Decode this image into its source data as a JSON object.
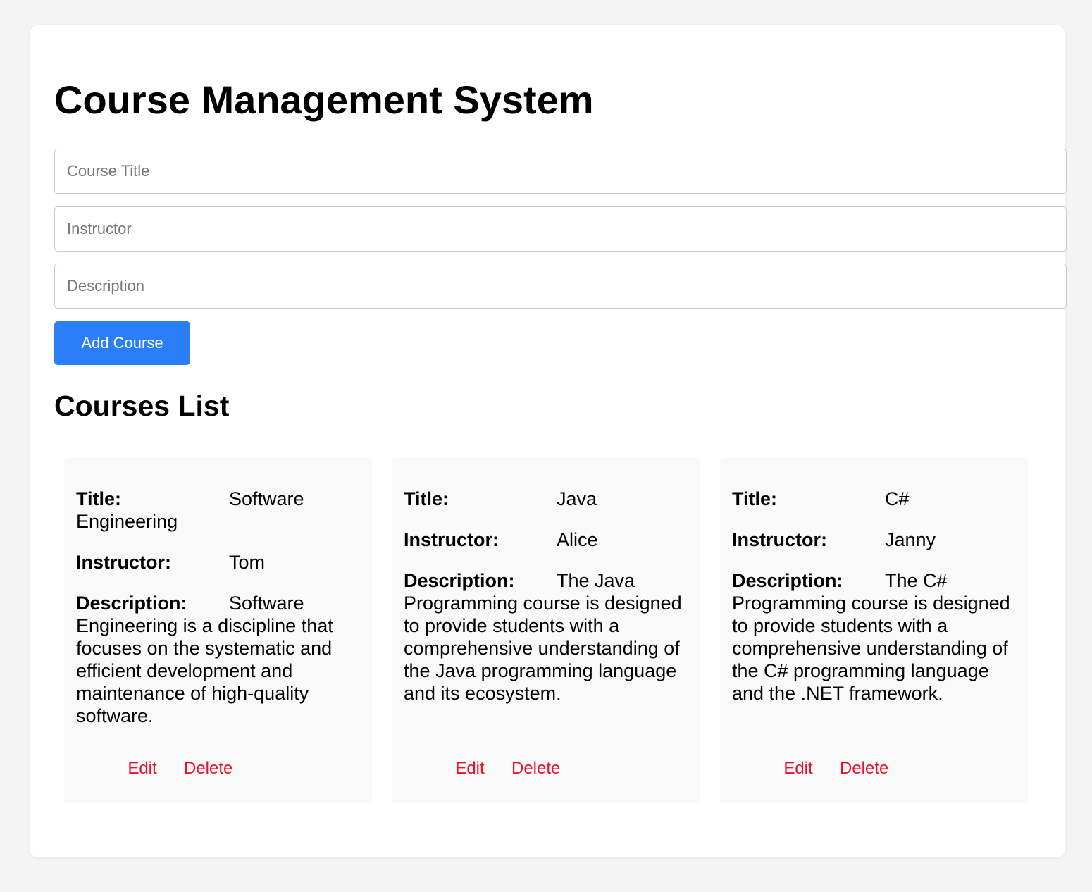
{
  "header": {
    "title": "Course Management System"
  },
  "form": {
    "title_placeholder": "Course Title",
    "instructor_placeholder": "Instructor",
    "description_placeholder": "Description",
    "title_value": "",
    "instructor_value": "",
    "description_value": "",
    "submit_label": "Add Course"
  },
  "list": {
    "heading": "Courses List",
    "labels": {
      "title": "Title:",
      "instructor": "Instructor:",
      "description": "Description:"
    },
    "actions": {
      "edit": "Edit",
      "delete": "Delete"
    },
    "courses": [
      {
        "title": "Software Engineering",
        "instructor": "Tom",
        "description": "Software Engineering is a discipline that focuses on the systematic and efficient development and maintenance of high-quality software."
      },
      {
        "title": "Java",
        "instructor": "Alice",
        "description": "The Java Programming course is designed to provide students with a comprehensive understanding of the Java programming language and its ecosystem."
      },
      {
        "title": "C#",
        "instructor": "Janny",
        "description": "The C# Programming course is designed to provide students with a comprehensive understanding of the C# programming language and the .NET framework."
      }
    ]
  },
  "colors": {
    "page_background": "#f4f4f4",
    "container_background": "#ffffff",
    "card_background": "#f9f9f9",
    "primary_button": "#2a7ff7",
    "action_link": "#e8102b"
  }
}
